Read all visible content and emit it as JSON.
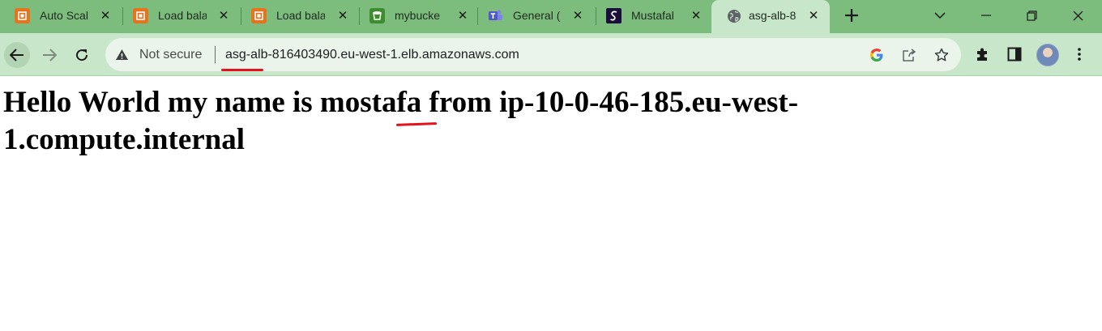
{
  "tabs": [
    {
      "title": "Auto Scal",
      "icon": "aws-ec2-icon",
      "active": false
    },
    {
      "title": "Load bala",
      "icon": "aws-ec2-icon",
      "active": false
    },
    {
      "title": "Load bala",
      "icon": "aws-ec2-icon",
      "active": false
    },
    {
      "title": "mybucke",
      "icon": "aws-s3-bucket-icon",
      "active": false
    },
    {
      "title": "General (",
      "icon": "teams-icon",
      "active": false
    },
    {
      "title": "Mustafal",
      "icon": "app-logo-icon",
      "active": false
    },
    {
      "title": "asg-alb-8",
      "icon": "globe-icon",
      "active": true
    }
  ],
  "toolbar": {
    "security_label": "Not secure",
    "url": "asg-alb-816403490.eu-west-1.elb.amazonaws.com"
  },
  "page": {
    "heading_line1": "Hello World my name is mostafa from ip-10-0-46-185.eu-west-",
    "heading_line2": "1.compute.internal"
  },
  "colors": {
    "tabstrip": "#7cbd7e",
    "toolbar": "#c8e6c9",
    "annotation": "#e3121c"
  }
}
